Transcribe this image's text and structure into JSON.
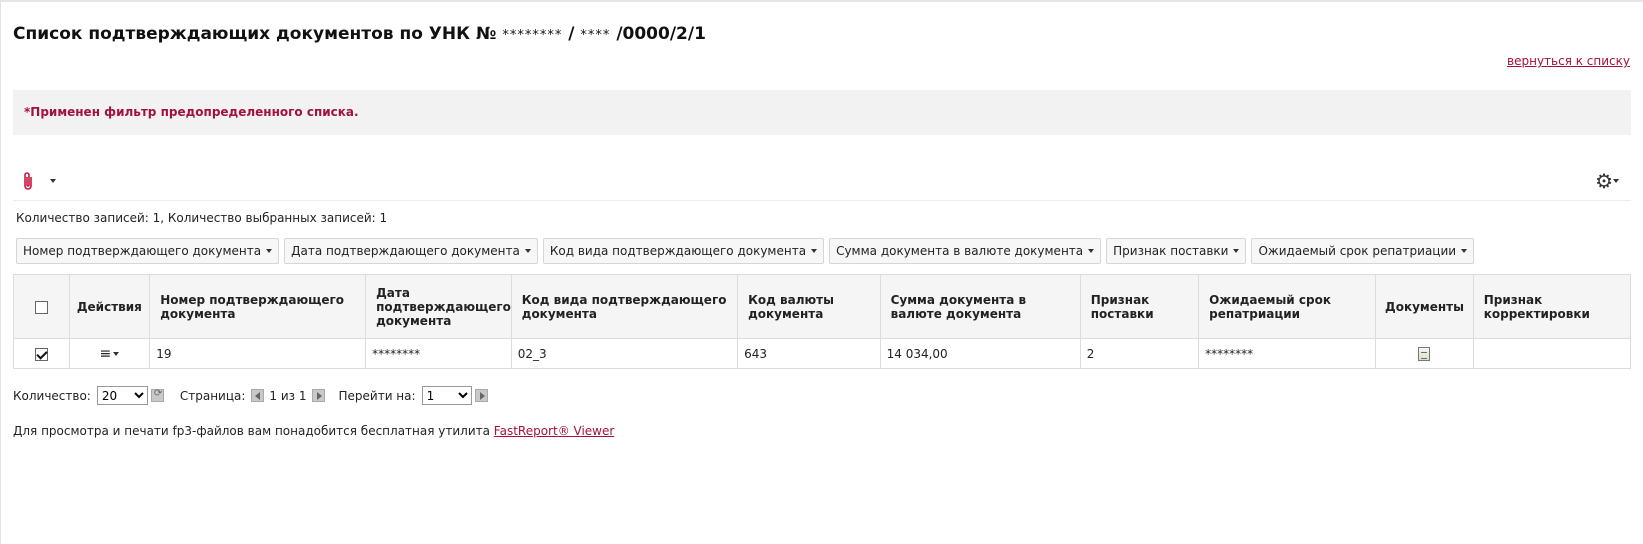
{
  "header": {
    "title_prefix": "Список подтверждающих документов по УНК №",
    "unk_part1": "********",
    "separator1": "/",
    "unk_part2": "****",
    "unk_suffix": "/0000/2/1"
  },
  "back_link": "вернуться к списку",
  "filter_banner": "*Применен фильтр предопределенного списка.",
  "toolbar": {
    "attach_icon": "paperclip-icon",
    "settings_icon": "gear-icon"
  },
  "counts_text": "Количество записей: 1, Количество выбранных записей: 1",
  "filter_buttons": [
    "Номер подтверждающего документа",
    "Дата подтверждающего документа",
    "Код вида подтверждающего документа",
    "Сумма документа в валюте документа",
    "Признак поставки",
    "Ожидаемый срок репатриации"
  ],
  "table": {
    "headers": {
      "actions": "Действия",
      "doc_number": "Номер подтверждающего документа",
      "doc_date": "Дата подтверждающего документа",
      "doc_type_code": "Код вида подтверждающего документа",
      "currency_code": "Код валюты документа",
      "amount": "Сумма документа в валюте документа",
      "delivery_flag": "Признак поставки",
      "repatriation_date": "Ожидаемый срок репатриации",
      "documents": "Документы",
      "correction_flag": "Признак корректировки"
    },
    "rows": [
      {
        "checked": true,
        "actions_icon": "≡",
        "doc_number": "19",
        "doc_date": "********",
        "doc_type_code": "02_3",
        "currency_code": "643",
        "amount": "14 034,00",
        "delivery_flag": "2",
        "repatriation_date": "********",
        "documents_icon": "document-icon",
        "correction_flag": ""
      }
    ]
  },
  "pager": {
    "count_label": "Количество:",
    "count_value": "20",
    "page_label": "Страница:",
    "page_info": "1 из 1",
    "goto_label": "Перейти на:",
    "goto_value": "1"
  },
  "footer": {
    "note_text": "Для просмотра и печати fp3-файлов вам понадобится бесплатная утилита ",
    "link_text": "FastReport® Viewer"
  }
}
